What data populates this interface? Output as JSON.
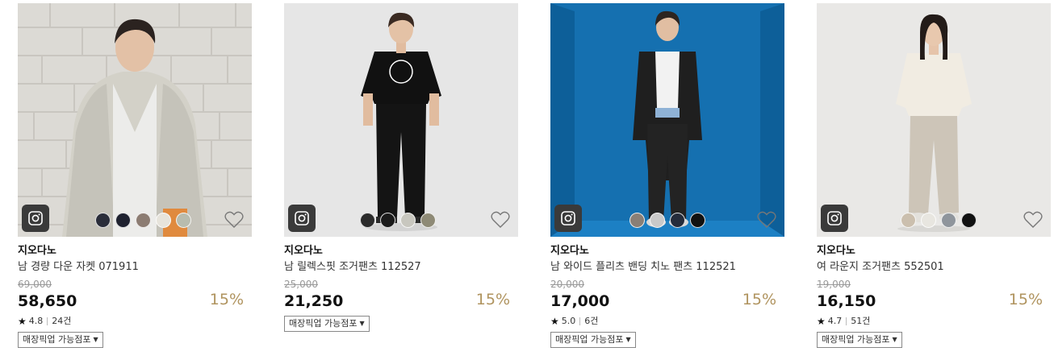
{
  "colors": {
    "discount": "#b0945f",
    "strike": "#999999"
  },
  "products": [
    {
      "brand": "지오다노",
      "name": "남 경량 다운 자켓 071911",
      "original_price": "69,000",
      "price": "58,650",
      "discount": "15%",
      "rating": "4.8",
      "reviews": "24건",
      "pickup_label": "매장픽업 가능점포",
      "swatches": [
        "#2a2d3a",
        "#1f2230",
        "#8c7c72",
        "#e7e4dc",
        "#b8bcae"
      ],
      "icons": [
        "instagram-icon",
        "heart-icon"
      ]
    },
    {
      "brand": "지오다노",
      "name": "남 릴렉스핏 조거팬츠 112527",
      "original_price": "25,000",
      "price": "21,250",
      "discount": "15%",
      "rating": "",
      "reviews": "",
      "pickup_label": "매장픽업 가능점포",
      "swatches": [
        "#2b2b2b",
        "#1a1a1a",
        "#c8c7bf",
        "#8e8a76"
      ],
      "icons": [
        "instagram-icon",
        "heart-icon"
      ]
    },
    {
      "brand": "지오다노",
      "name": "남 와이드 플리츠 밴딩 치노 팬츠 112521",
      "original_price": "20,000",
      "price": "17,000",
      "discount": "15%",
      "rating": "5.0",
      "reviews": "6건",
      "pickup_label": "매장픽업 가능점포",
      "swatches": [
        "#8a7f76",
        "#c9c9c9",
        "#252c3b",
        "#111111"
      ],
      "icons": [
        "instagram-icon",
        "heart-icon"
      ]
    },
    {
      "brand": "지오다노",
      "name": "여 라운지 조거팬츠 552501",
      "original_price": "19,000",
      "price": "16,150",
      "discount": "15%",
      "rating": "4.7",
      "reviews": "51건",
      "pickup_label": "매장픽업 가능점포",
      "swatches": [
        "#cbbfae",
        "#e8e6e0",
        "#8f959c",
        "#111111"
      ],
      "icons": [
        "instagram-icon",
        "heart-icon"
      ]
    }
  ]
}
